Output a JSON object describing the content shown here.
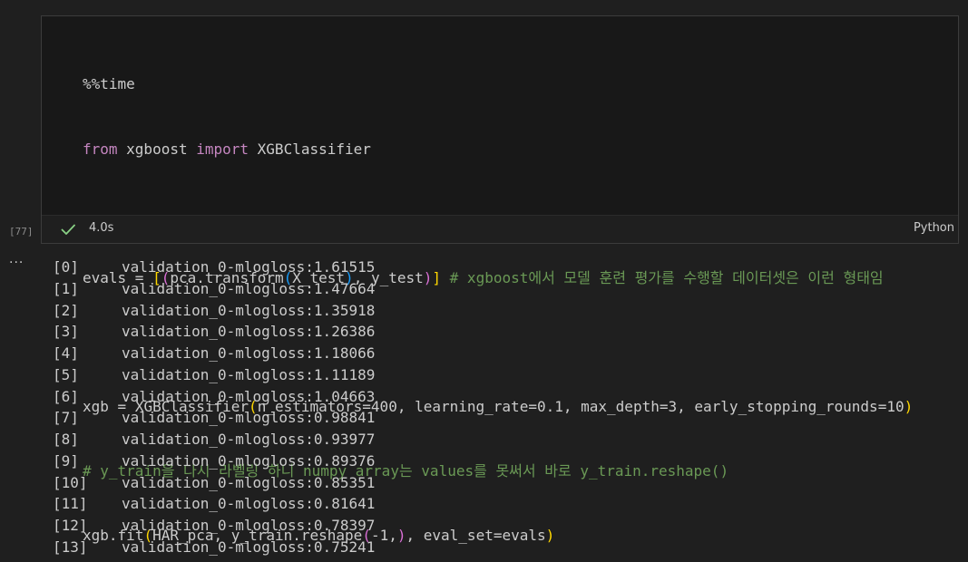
{
  "cell": {
    "execution_count": "[77]",
    "status": "4.0s",
    "language": "Python",
    "code": {
      "l1": "%%time",
      "l2_kw1": "from",
      "l2_mod": " xgboost ",
      "l2_kw2": "import",
      "l2_cls": " XGBClassifier",
      "l4_var": "evals",
      "l4_eq": " = ",
      "l4_b1": "[",
      "l4_b2": "(",
      "l4_pca": "pca",
      "l4_dot": ".",
      "l4_fn": "transform",
      "l4_b3": "(",
      "l4_xtest": "X_test",
      "l4_b3c": ")",
      "l4_comma": ", ",
      "l4_ytest": "y_test",
      "l4_b2c": ")",
      "l4_b1c": "]",
      "l4_cmt": " # xgboost에서 모델 훈련 평가를 수행할 데이터셋은 이런 형태임",
      "l6_var": "xgb",
      "l6_eq": " = ",
      "l6_cls": "XGBClassifier",
      "l6_b1": "(",
      "l6_p1": "n_estimators",
      "l6_eq1": "=",
      "l6_v1": "400",
      "l6_c1": ", ",
      "l6_p2": "learning_rate",
      "l6_eq2": "=",
      "l6_v2": "0.1",
      "l6_c2": ", ",
      "l6_p3": "max_depth",
      "l6_eq3": "=",
      "l6_v3": "3",
      "l6_c3": ", ",
      "l6_p4": "early_stopping_rounds",
      "l6_eq4": "=",
      "l6_v4": "10",
      "l6_b1c": ")",
      "l7_cmt": "# y_train을 다시 라벨링 하니 numpy array는 values를 못써서 바로 y_train.reshape()",
      "l8_var": "xgb",
      "l8_dot": ".",
      "l8_fn": "fit",
      "l8_b1": "(",
      "l8_a1": "HAR_pca",
      "l8_c1": ", ",
      "l8_a2": "y_train",
      "l8_dot2": ".",
      "l8_fn2": "reshape",
      "l8_b2": "(",
      "l8_v": "-1",
      "l8_c2": ",",
      "l8_b2c": ")",
      "l8_c3": ", ",
      "l8_p": "eval_set",
      "l8_eq": "=",
      "l8_a3": "evals",
      "l8_b1c": ")"
    }
  },
  "output": {
    "lines": [
      {
        "idx": "[0]",
        "text": "validation_0-mlogloss:1.61515"
      },
      {
        "idx": "[1]",
        "text": "validation_0-mlogloss:1.47664"
      },
      {
        "idx": "[2]",
        "text": "validation_0-mlogloss:1.35918"
      },
      {
        "idx": "[3]",
        "text": "validation_0-mlogloss:1.26386"
      },
      {
        "idx": "[4]",
        "text": "validation_0-mlogloss:1.18066"
      },
      {
        "idx": "[5]",
        "text": "validation_0-mlogloss:1.11189"
      },
      {
        "idx": "[6]",
        "text": "validation_0-mlogloss:1.04663"
      },
      {
        "idx": "[7]",
        "text": "validation_0-mlogloss:0.98841"
      },
      {
        "idx": "[8]",
        "text": "validation_0-mlogloss:0.93977"
      },
      {
        "idx": "[9]",
        "text": "validation_0-mlogloss:0.89376"
      },
      {
        "idx": "[10]",
        "text": "validation_0-mlogloss:0.85351"
      },
      {
        "idx": "[11]",
        "text": "validation_0-mlogloss:0.81641"
      },
      {
        "idx": "[12]",
        "text": "validation_0-mlogloss:0.78397"
      },
      {
        "idx": "[13]",
        "text": "validation_0-mlogloss:0.75241"
      }
    ]
  },
  "icons": {
    "check": "check-icon",
    "more": "more-actions-icon"
  },
  "colors": {
    "background": "#1f1f1f",
    "editor_background": "#181818",
    "success_check": "#89d185"
  }
}
